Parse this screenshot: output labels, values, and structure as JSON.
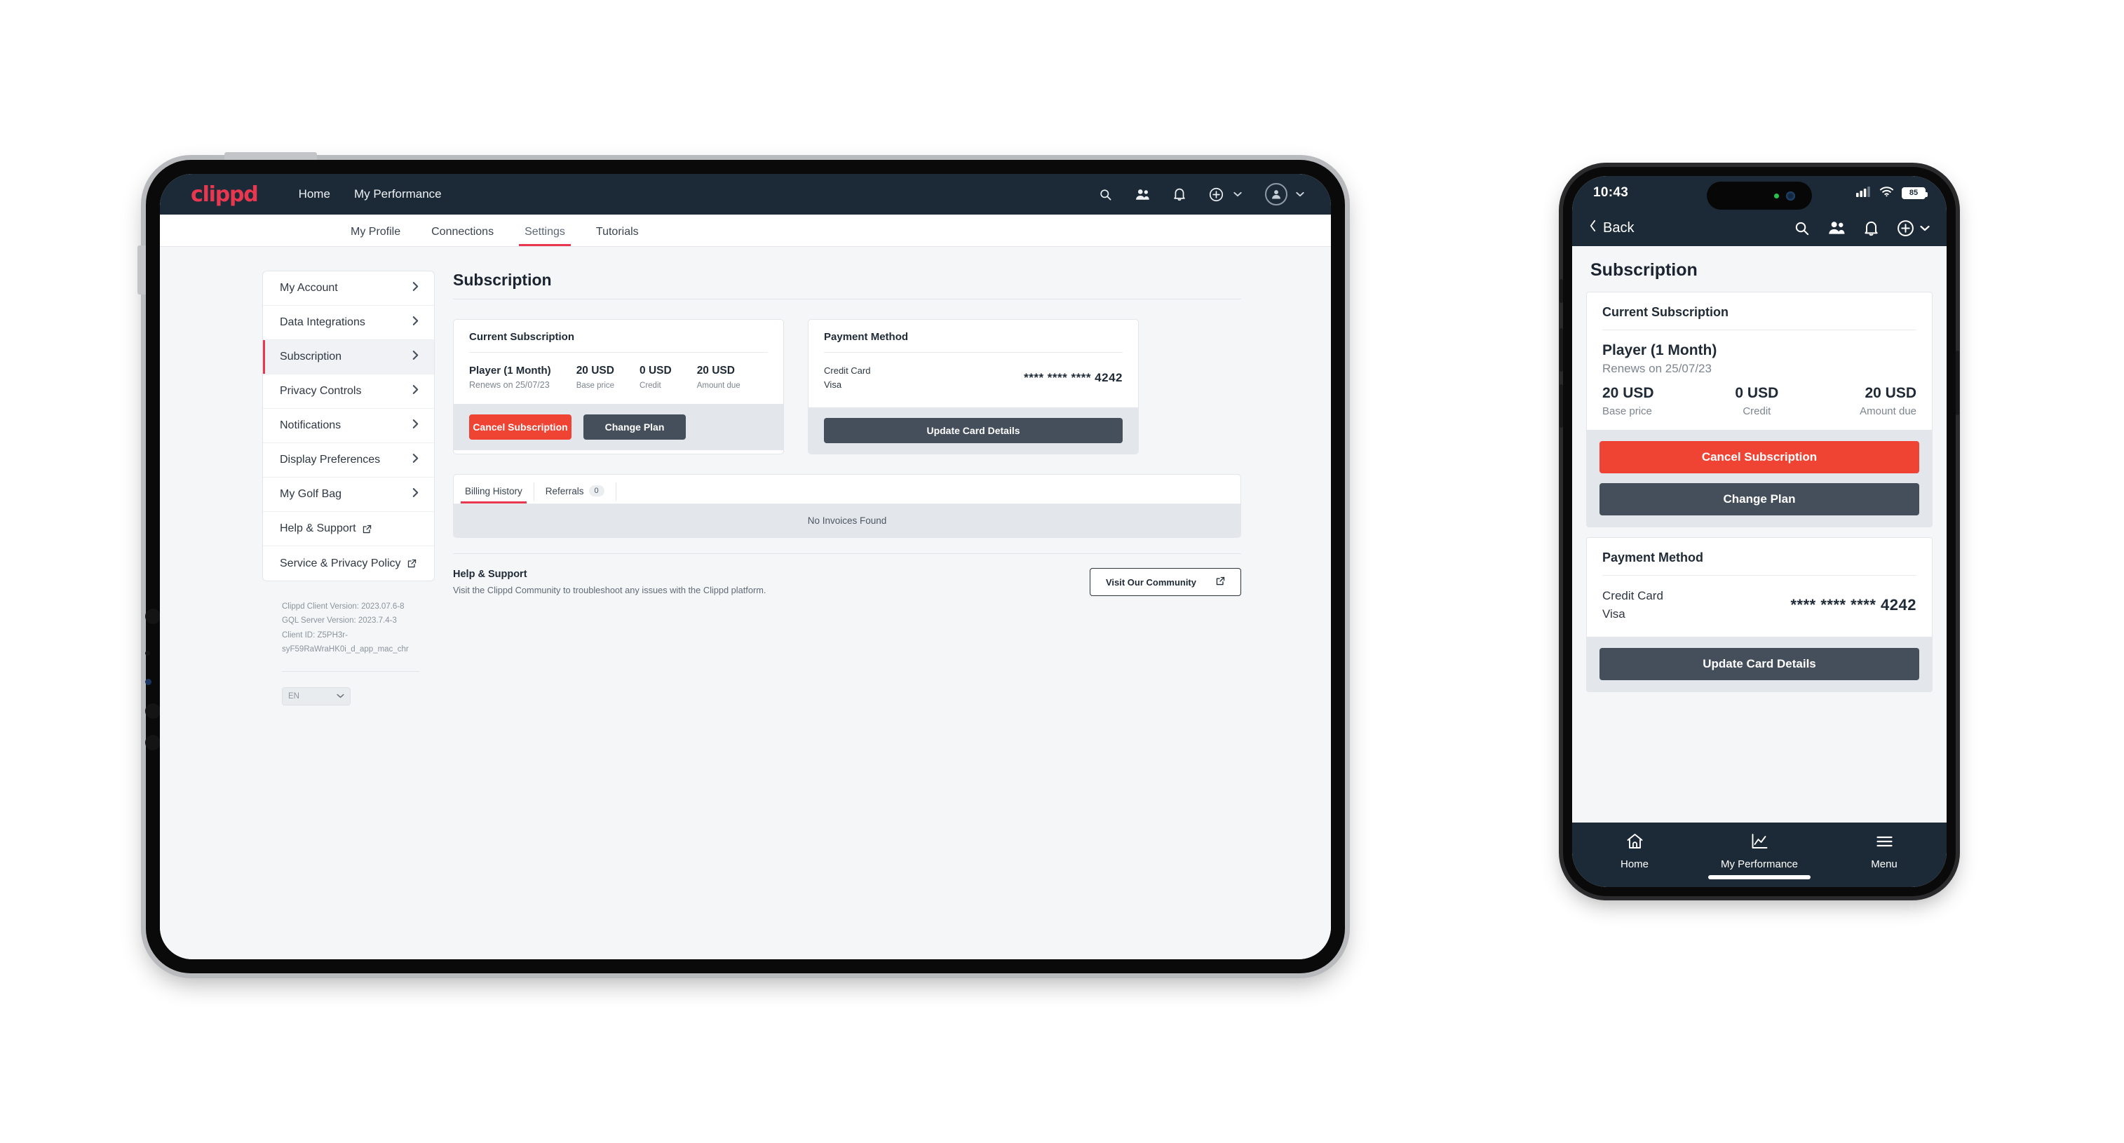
{
  "brand": {
    "name": "clippd",
    "accent": "#e8374f",
    "navbar_bg": "#1c2a38"
  },
  "tablet": {
    "topnav": {
      "links": [
        "Home",
        "My Performance"
      ]
    },
    "subtabs": [
      {
        "label": "My Profile",
        "active": false
      },
      {
        "label": "Connections",
        "active": false
      },
      {
        "label": "Settings",
        "active": true
      },
      {
        "label": "Tutorials",
        "active": false
      }
    ],
    "sidebar": {
      "items": [
        {
          "label": "My Account",
          "type": "chevron",
          "active": false
        },
        {
          "label": "Data Integrations",
          "type": "chevron",
          "active": false
        },
        {
          "label": "Subscription",
          "type": "chevron",
          "active": true
        },
        {
          "label": "Privacy Controls",
          "type": "chevron",
          "active": false
        },
        {
          "label": "Notifications",
          "type": "chevron",
          "active": false
        },
        {
          "label": "Display Preferences",
          "type": "chevron",
          "active": false
        },
        {
          "label": "My Golf Bag",
          "type": "chevron",
          "active": false
        },
        {
          "label": "Help & Support",
          "type": "external",
          "active": false
        },
        {
          "label": "Service & Privacy Policy",
          "type": "external",
          "active": false
        }
      ],
      "versions": [
        "Clippd Client Version: 2023.07.6-8",
        "GQL Server Version: 2023.7.4-3",
        "Client ID: Z5PH3r-syF59RaWraHK0i_d_app_mac_chr"
      ],
      "language": "EN"
    },
    "main": {
      "title": "Subscription",
      "subscription_card": {
        "heading": "Current Subscription",
        "plan_name": "Player (1 Month)",
        "renews": "Renews on 25/07/23",
        "stats": [
          {
            "value": "20 USD",
            "label": "Base price"
          },
          {
            "value": "0 USD",
            "label": "Credit"
          },
          {
            "value": "20 USD",
            "label": "Amount due"
          }
        ],
        "cancel_label": "Cancel Subscription",
        "change_label": "Change Plan"
      },
      "payment_card": {
        "heading": "Payment Method",
        "type": "Credit Card",
        "brand": "Visa",
        "number": "**** **** **** 4242",
        "update_label": "Update Card Details"
      },
      "history": {
        "tabs": [
          {
            "label": "Billing History",
            "active": true
          },
          {
            "label": "Referrals",
            "badge": "0",
            "active": false
          }
        ],
        "empty_text": "No Invoices Found"
      },
      "help": {
        "title": "Help & Support",
        "description": "Visit the Clippd Community to troubleshoot any issues with the Clippd platform.",
        "button_label": "Visit Our Community"
      }
    }
  },
  "phone": {
    "status": {
      "time": "10:43",
      "battery": "85"
    },
    "appbar": {
      "back_label": "Back"
    },
    "title": "Subscription",
    "subscription_card": {
      "heading": "Current Subscription",
      "plan_name": "Player (1 Month)",
      "renews": "Renews on 25/07/23",
      "stats": [
        {
          "value": "20 USD",
          "label": "Base price"
        },
        {
          "value": "0 USD",
          "label": "Credit"
        },
        {
          "value": "20 USD",
          "label": "Amount due"
        }
      ],
      "cancel_label": "Cancel Subscription",
      "change_label": "Change Plan"
    },
    "payment_card": {
      "heading": "Payment Method",
      "type": "Credit Card",
      "brand": "Visa",
      "number": "**** **** **** 4242",
      "update_label": "Update Card Details"
    },
    "tabbar": [
      {
        "label": "Home",
        "icon": "home-icon"
      },
      {
        "label": "My Performance",
        "icon": "chart-icon"
      },
      {
        "label": "Menu",
        "icon": "hamburger-icon"
      }
    ]
  }
}
